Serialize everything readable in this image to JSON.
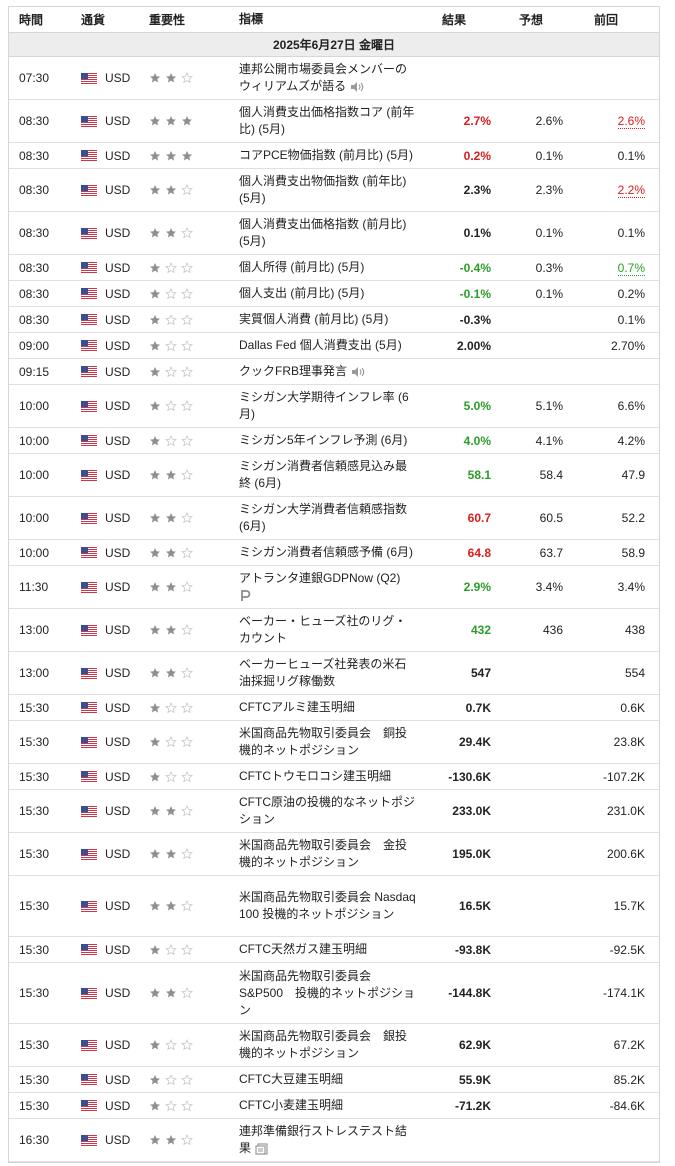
{
  "header": {
    "time": "時間",
    "currency": "通貨",
    "importance": "重要性",
    "event": "指標",
    "actual": "結果",
    "forecast": "予想",
    "previous": "前回"
  },
  "date_label": "2025年6月27日 金曜日",
  "colors": {
    "positive": "#2a9d2a",
    "negative": "#d91c1c",
    "star_on": "#8f8f8f",
    "star_off": "#c8c8c8"
  },
  "rows": [
    {
      "time": "07:30",
      "cur": "USD",
      "imp": 2,
      "event": "連邦公開市場委員会メンバーのウィリアムズが語る",
      "icon": "speaker-icon",
      "actual": "",
      "actual_style": "",
      "forecast": "",
      "previous": "",
      "prev_style": ""
    },
    {
      "time": "08:30",
      "cur": "USD",
      "imp": 3,
      "event": "個人消費支出価格指数コア (前年比) (5月)",
      "icon": "",
      "actual": "2.7%",
      "actual_style": "neg",
      "forecast": "2.6%",
      "previous": "2.6%",
      "prev_style": "rev-neg"
    },
    {
      "time": "08:30",
      "cur": "USD",
      "imp": 3,
      "event": "コアPCE物価指数 (前月比) (5月)",
      "icon": "",
      "actual": "0.2%",
      "actual_style": "neg",
      "forecast": "0.1%",
      "previous": "0.1%",
      "prev_style": ""
    },
    {
      "time": "08:30",
      "cur": "USD",
      "imp": 2,
      "event": "個人消費支出物価指数 (前年比) (5月)",
      "icon": "",
      "actual": "2.3%",
      "actual_style": "",
      "forecast": "2.3%",
      "previous": "2.2%",
      "prev_style": "rev-neg"
    },
    {
      "time": "08:30",
      "cur": "USD",
      "imp": 2,
      "event": "個人消費支出価格指数 (前月比) (5月)",
      "icon": "",
      "actual": "0.1%",
      "actual_style": "",
      "forecast": "0.1%",
      "previous": "0.1%",
      "prev_style": ""
    },
    {
      "time": "08:30",
      "cur": "USD",
      "imp": 1,
      "event": "個人所得 (前月比) (5月)",
      "icon": "",
      "actual": "-0.4%",
      "actual_style": "pos",
      "forecast": "0.3%",
      "previous": "0.7%",
      "prev_style": "rev-pos"
    },
    {
      "time": "08:30",
      "cur": "USD",
      "imp": 1,
      "event": "個人支出 (前月比) (5月)",
      "icon": "",
      "actual": "-0.1%",
      "actual_style": "pos",
      "forecast": "0.1%",
      "previous": "0.2%",
      "prev_style": ""
    },
    {
      "time": "08:30",
      "cur": "USD",
      "imp": 1,
      "event": "実質個人消費 (前月比) (5月)",
      "icon": "",
      "actual": "-0.3%",
      "actual_style": "",
      "forecast": "",
      "previous": "0.1%",
      "prev_style": ""
    },
    {
      "time": "09:00",
      "cur": "USD",
      "imp": 1,
      "event": "Dallas Fed 個人消費支出 (5月)",
      "icon": "",
      "actual": "2.00%",
      "actual_style": "",
      "forecast": "",
      "previous": "2.70%",
      "prev_style": ""
    },
    {
      "time": "09:15",
      "cur": "USD",
      "imp": 1,
      "event": "クックFRB理事発言",
      "icon": "speaker-icon",
      "actual": "",
      "actual_style": "",
      "forecast": "",
      "previous": "",
      "prev_style": ""
    },
    {
      "time": "10:00",
      "cur": "USD",
      "imp": 1,
      "event": "ミシガン大学期待インフレ率 (6月)",
      "icon": "",
      "actual": "5.0%",
      "actual_style": "pos",
      "forecast": "5.1%",
      "previous": "6.6%",
      "prev_style": ""
    },
    {
      "time": "10:00",
      "cur": "USD",
      "imp": 1,
      "event": "ミシガン5年インフレ予測 (6月)",
      "icon": "",
      "actual": "4.0%",
      "actual_style": "pos",
      "forecast": "4.1%",
      "previous": "4.2%",
      "prev_style": ""
    },
    {
      "time": "10:00",
      "cur": "USD",
      "imp": 2,
      "event": "ミシガン消費者信頼感見込み最終 (6月)",
      "icon": "",
      "actual": "58.1",
      "actual_style": "pos",
      "forecast": "58.4",
      "previous": "47.9",
      "prev_style": ""
    },
    {
      "time": "10:00",
      "cur": "USD",
      "imp": 2,
      "event": "ミシガン大学消費者信頼感指数 (6月)",
      "icon": "",
      "actual": "60.7",
      "actual_style": "neg",
      "forecast": "60.5",
      "previous": "52.2",
      "prev_style": ""
    },
    {
      "time": "10:00",
      "cur": "USD",
      "imp": 2,
      "event": "ミシガン消費者信頼感予備 (6月)",
      "icon": "",
      "actual": "64.8",
      "actual_style": "neg",
      "forecast": "63.7",
      "previous": "58.9",
      "prev_style": ""
    },
    {
      "time": "11:30",
      "cur": "USD",
      "imp": 2,
      "event": "アトランタ連銀GDPNow (Q2)",
      "icon": "p-icon",
      "actual": "2.9%",
      "actual_style": "pos",
      "forecast": "3.4%",
      "previous": "3.4%",
      "prev_style": ""
    },
    {
      "time": "13:00",
      "cur": "USD",
      "imp": 2,
      "event": "ベーカー・ヒューズ社のリグ・カウント",
      "icon": "",
      "actual": "432",
      "actual_style": "pos",
      "forecast": "436",
      "previous": "438",
      "prev_style": ""
    },
    {
      "time": "13:00",
      "cur": "USD",
      "imp": 2,
      "event": "ベーカーヒューズ社発表の米石油採掘リグ稼働数",
      "icon": "",
      "actual": "547",
      "actual_style": "",
      "forecast": "",
      "previous": "554",
      "prev_style": ""
    },
    {
      "time": "15:30",
      "cur": "USD",
      "imp": 1,
      "event": "CFTCアルミ建玉明細",
      "icon": "",
      "actual": "0.7K",
      "actual_style": "",
      "forecast": "",
      "previous": "0.6K",
      "prev_style": ""
    },
    {
      "time": "15:30",
      "cur": "USD",
      "imp": 1,
      "event": "米国商品先物取引委員会　銅投機的ネットポジション",
      "icon": "",
      "actual": "29.4K",
      "actual_style": "",
      "forecast": "",
      "previous": "23.8K",
      "prev_style": ""
    },
    {
      "time": "15:30",
      "cur": "USD",
      "imp": 1,
      "event": "CFTCトウモロコシ建玉明細",
      "icon": "",
      "actual": "-130.6K",
      "actual_style": "",
      "forecast": "",
      "previous": "-107.2K",
      "prev_style": ""
    },
    {
      "time": "15:30",
      "cur": "USD",
      "imp": 2,
      "event": "CFTC原油の投機的なネットポジション",
      "icon": "",
      "actual": "233.0K",
      "actual_style": "",
      "forecast": "",
      "previous": "231.0K",
      "prev_style": ""
    },
    {
      "time": "15:30",
      "cur": "USD",
      "imp": 2,
      "event": "米国商品先物取引委員会　金投機的ネットポジション",
      "icon": "",
      "actual": "195.0K",
      "actual_style": "",
      "forecast": "",
      "previous": "200.6K",
      "prev_style": ""
    },
    {
      "time": "15:30",
      "cur": "USD",
      "imp": 2,
      "event": "米国商品先物取引委員会 Nasdaq 100 投機的ネットポジション",
      "icon": "",
      "actual": "16.5K",
      "actual_style": "",
      "forecast": "",
      "previous": "15.7K",
      "prev_style": ""
    },
    {
      "time": "15:30",
      "cur": "USD",
      "imp": 1,
      "event": "CFTC天然ガス建玉明細",
      "icon": "",
      "actual": "-93.8K",
      "actual_style": "",
      "forecast": "",
      "previous": "-92.5K",
      "prev_style": ""
    },
    {
      "time": "15:30",
      "cur": "USD",
      "imp": 2,
      "event": "米国商品先物取引委員会 S&P500　投機的ネットポジション",
      "icon": "",
      "actual": "-144.8K",
      "actual_style": "",
      "forecast": "",
      "previous": "-174.1K",
      "prev_style": ""
    },
    {
      "time": "15:30",
      "cur": "USD",
      "imp": 1,
      "event": "米国商品先物取引委員会　銀投機的ネットポジション",
      "icon": "",
      "actual": "62.9K",
      "actual_style": "",
      "forecast": "",
      "previous": "67.2K",
      "prev_style": ""
    },
    {
      "time": "15:30",
      "cur": "USD",
      "imp": 1,
      "event": "CFTC大豆建玉明細",
      "icon": "",
      "actual": "55.9K",
      "actual_style": "",
      "forecast": "",
      "previous": "85.2K",
      "prev_style": ""
    },
    {
      "time": "15:30",
      "cur": "USD",
      "imp": 1,
      "event": "CFTC小麦建玉明細",
      "icon": "",
      "actual": "-71.2K",
      "actual_style": "",
      "forecast": "",
      "previous": "-84.6K",
      "prev_style": ""
    },
    {
      "time": "16:30",
      "cur": "USD",
      "imp": 2,
      "event": "連邦準備銀行ストレステスト結果",
      "icon": "document-icon",
      "actual": "",
      "actual_style": "",
      "forecast": "",
      "previous": "",
      "prev_style": ""
    }
  ]
}
